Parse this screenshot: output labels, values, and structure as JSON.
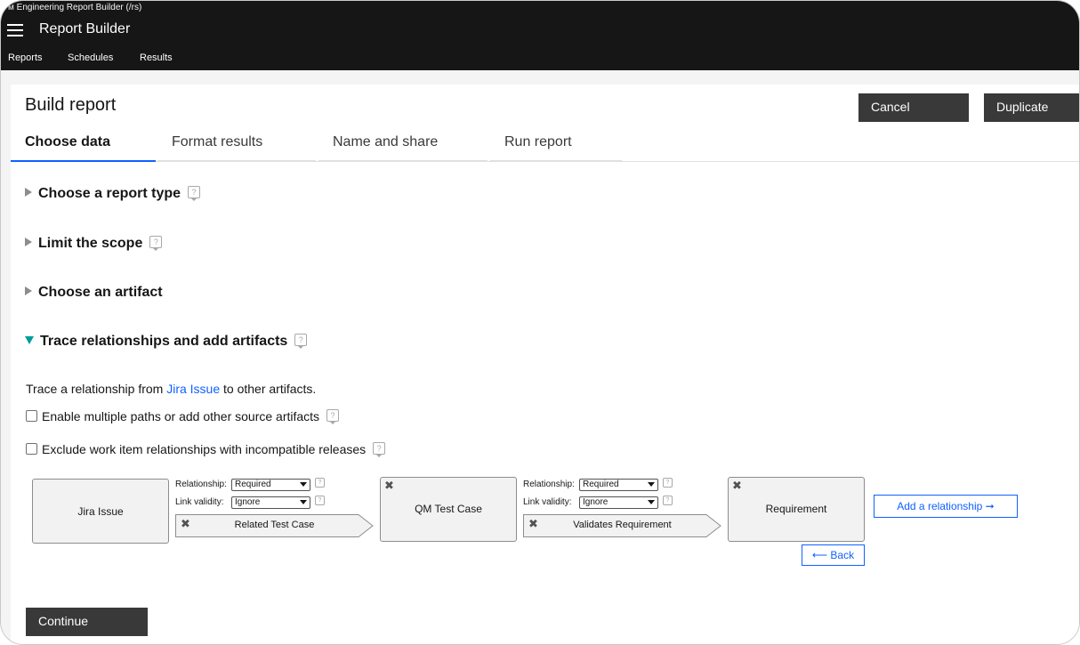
{
  "app": {
    "caption": "ᴍ Engineering Report Builder (/rs)",
    "title": "Report Builder",
    "nav": [
      "Reports",
      "Schedules",
      "Results"
    ]
  },
  "page": {
    "title": "Build report",
    "cancel_label": "Cancel",
    "duplicate_label": "Duplicate",
    "continue_label": "Continue"
  },
  "tabs": [
    {
      "label": "Choose data",
      "active": true
    },
    {
      "label": "Format results",
      "active": false
    },
    {
      "label": "Name and share",
      "active": false
    },
    {
      "label": "Run report",
      "active": false
    }
  ],
  "sections": {
    "report_type": "Choose a report type",
    "scope": "Limit the scope",
    "artifact": "Choose an artifact",
    "trace": "Trace relationships and add artifacts"
  },
  "help_glyph": "?",
  "trace": {
    "prefix": "Trace a relationship from ",
    "link": "Jira Issue",
    "suffix": " to other artifacts.",
    "enable_multiple": "Enable multiple paths or add other source artifacts",
    "exclude_incompatible": "Exclude work item relationships with incompatible releases"
  },
  "diagram": {
    "node1": "Jira Issue",
    "node2": "QM Test Case",
    "node3": "Requirement",
    "relationship_label": "Relationship:",
    "validity_label": "Link validity:",
    "link1": {
      "relationship": "Required",
      "validity": "Ignore",
      "name": "Related Test Case"
    },
    "link2": {
      "relationship": "Required",
      "validity": "Ignore",
      "name": "Validates Requirement"
    },
    "remove_glyph": "✖",
    "add_relationship": "Add a relationship",
    "back": "Back",
    "arrow_right": "➞",
    "arrow_left": "⟵"
  }
}
